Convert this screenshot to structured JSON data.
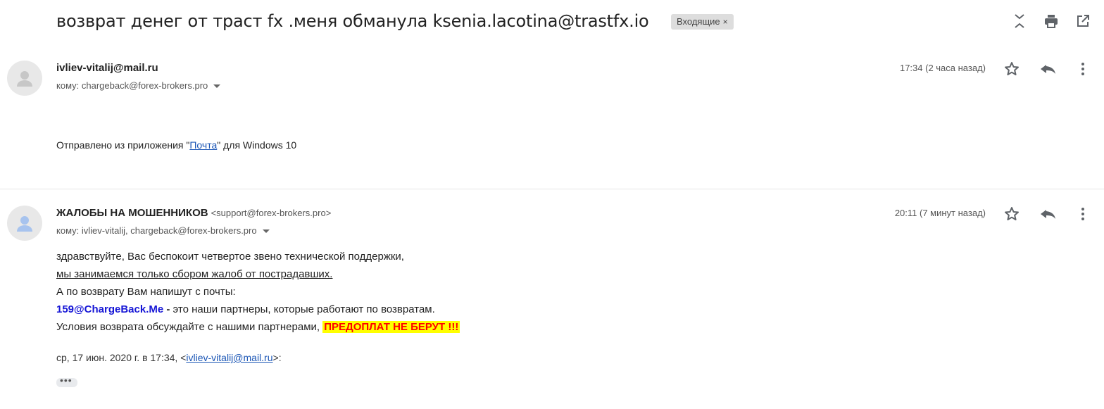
{
  "subject": {
    "title": "возврат денег от траст fx .меня обманула ksenia.lacotina@trastfx.io",
    "label": "Входящие",
    "label_remove": "×"
  },
  "toolbar": {
    "icons": [
      "expand-collapse-icon",
      "print-icon",
      "open-in-new-window-icon"
    ]
  },
  "messages": [
    {
      "sender_name": "ivliev-vitalij@mail.ru",
      "sender_email": "",
      "to": "кому: chargeback@forex-brokers.pro",
      "time": "17:34 (2 часа назад)",
      "body": {
        "prefix": "Отправлено из приложения \"",
        "link": "Почта",
        "suffix": "\" для Windows 10"
      }
    },
    {
      "sender_name": "ЖАЛОБЫ НА МОШЕННИКОВ",
      "sender_email": "<support@forex-brokers.pro>",
      "to": "кому: ivliev-vitalij, chargeback@forex-brokers.pro",
      "time": "20:11 (7 минут назад)",
      "body": {
        "line1": "здравствуйте, Вас беспокоит четвертое звено технической поддержки,",
        "line2": "мы занимаемся только сбором жалоб от пострадавших.",
        "line3": "А по возврату Вам напишут с почты:",
        "line4_email": "159@ChargeBack.Me",
        "line4_dash": " - ",
        "line4_rest": "это наши партнеры, которые работают по возвратам.",
        "line5": "Условия возврата обсуждайте с нашими партнерами, ",
        "line5_warn": "ПРЕДОПЛАТ НЕ БЕРУТ !!!"
      },
      "quote": {
        "prefix": "ср, 17 июн. 2020 г. в 17:34, <",
        "email": "ivliev-vitalij@mail.ru",
        "suffix": ">:"
      },
      "ellipsis": "•••"
    }
  ],
  "colors": {
    "link": "#1a55b5",
    "partner_email": "#1515d6",
    "warning_text": "#ff0000",
    "warning_bg": "#ffff00"
  }
}
